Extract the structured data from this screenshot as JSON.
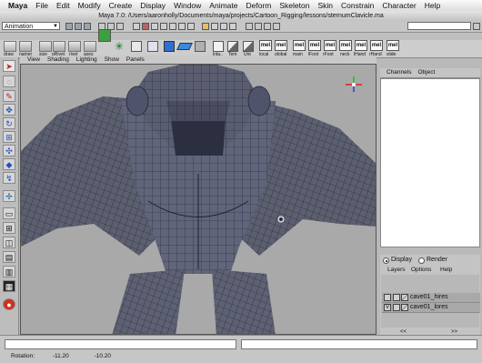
{
  "menubar": {
    "app": "Maya",
    "items": [
      "File",
      "Edit",
      "Modify",
      "Create",
      "Display",
      "Window",
      "Animate",
      "Deform",
      "Skeleton",
      "Skin",
      "Constrain",
      "Character",
      "Help"
    ]
  },
  "window": {
    "title": "Maya 7.0: /Users/aaronholly/Documents/maya/projects/Cartoon_Rigging/lessons/sternumClavicle.ma"
  },
  "statusline": {
    "mode": "Animation"
  },
  "shelf": {
    "labels": [
      "draw",
      "namer",
      "size",
      "pRivet",
      "rivet",
      "axes"
    ],
    "mel_label": "mel",
    "right_labels": [
      "inta..",
      "Tem",
      "Unt",
      "local",
      "global",
      "main",
      "lFoot",
      "rFoot",
      "neck",
      "lHand",
      "rHand",
      "slide"
    ]
  },
  "panel_menu": [
    "View",
    "Shading",
    "Lighting",
    "Show",
    "Panels"
  ],
  "channel_box": {
    "tabs": [
      "Channels",
      "Object"
    ]
  },
  "layer_editor": {
    "display_label": "Display",
    "render_label": "Render",
    "menu": [
      "Layers",
      "Options",
      "Help"
    ],
    "layers": [
      {
        "name": "cave01_hires",
        "visible": ""
      },
      {
        "name": "cave01_lores",
        "visible": "V"
      }
    ],
    "nav_left": "<<",
    "nav_right": ">>"
  },
  "helpline": {
    "label": "Rotation:",
    "x": "-11.20",
    "y": "-10.20"
  },
  "colors": {
    "mesh_fill": "#5b5f6e",
    "wire": "#1d2038",
    "viewport_bg": "#a9a9a9",
    "axis_x": "#e02020",
    "axis_y": "#20c020",
    "axis_z": "#2040e0"
  }
}
